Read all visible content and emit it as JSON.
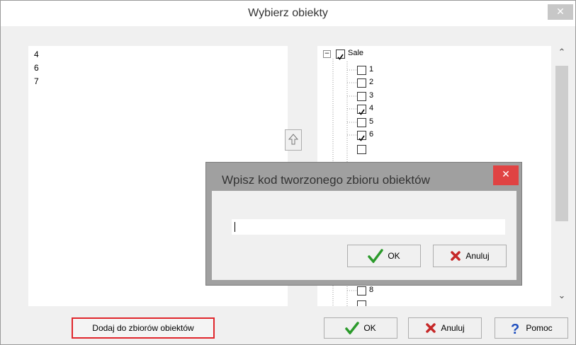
{
  "outer_window": {
    "title": "Wybierz obiekty",
    "close_glyph": "✕"
  },
  "left_list": {
    "items": [
      "4",
      "6",
      "7"
    ]
  },
  "tree": {
    "root": {
      "label": "Sale",
      "checked": true,
      "expand_glyph": "⊟"
    },
    "children": [
      {
        "label": "1",
        "checked": false
      },
      {
        "label": "2",
        "checked": false
      },
      {
        "label": "3",
        "checked": false
      },
      {
        "label": "4",
        "checked": true
      },
      {
        "label": "5",
        "checked": false
      },
      {
        "label": "6",
        "checked": true
      },
      {
        "label": "8",
        "checked": false
      }
    ],
    "scroll_up_glyph": "⌃",
    "scroll_down_glyph": "⌄"
  },
  "buttons": {
    "add_sets": "Dodaj do zbiorów obiektów",
    "ok": "OK",
    "cancel": "Anuluj",
    "help": "Pomoc"
  },
  "modal": {
    "title": "Wpisz kod tworzonego zbioru obiektów",
    "close_glyph": "✕",
    "input_value": "",
    "ok": "OK",
    "cancel": "Anuluj"
  },
  "colors": {
    "ok_check": "#2b9a2b",
    "cancel_x": "#c62828",
    "help_question": "#1f4fbf",
    "highlight_border": "#e0262c",
    "modal_close": "#e04343"
  },
  "icons": {
    "ok": "checkmark-icon",
    "cancel": "red-x-icon",
    "help": "question-icon",
    "move_up": "up-arrow-icon"
  }
}
